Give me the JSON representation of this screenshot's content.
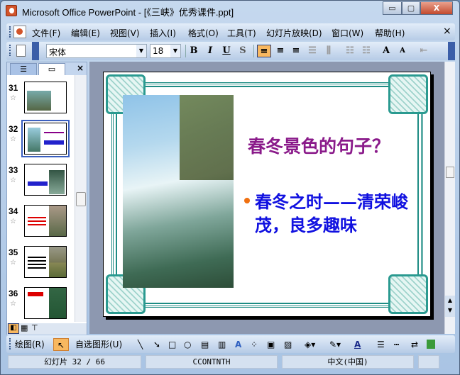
{
  "window": {
    "title": "Microsoft Office PowerPoint - [《三峡》优秀课件.ppt]",
    "minimize": "▭",
    "maximize": "▢",
    "close": "X"
  },
  "menu": {
    "items": [
      "文件(F)",
      "编辑(E)",
      "视图(V)",
      "插入(I)",
      "格式(O)",
      "工具(T)",
      "幻灯片放映(D)",
      "窗口(W)",
      "帮助(H)"
    ],
    "close": "×"
  },
  "format_toolbar": {
    "font": "宋体",
    "size": "18",
    "bold": "B",
    "italic": "I",
    "underline": "U",
    "shadow": "S",
    "increase_font": "A",
    "decrease_font": "A"
  },
  "left_pane": {
    "close": "×",
    "slides": [
      {
        "num": "31"
      },
      {
        "num": "32"
      },
      {
        "num": "33"
      },
      {
        "num": "34"
      },
      {
        "num": "35"
      },
      {
        "num": "36"
      }
    ],
    "selected": "32"
  },
  "slide": {
    "title": "春冬景色的句子？",
    "bullet": "春冬之时——清荣峻茂，良多趣味",
    "colors": {
      "title": "#8a1a8a",
      "bullet_text": "#1010e0",
      "bullet_dot": "#f07010",
      "border": "#1e8c84"
    }
  },
  "draw_toolbar": {
    "draw": "绘图(R)",
    "autoshapes": "自选图形(U)",
    "font_color": "A"
  },
  "status": {
    "slide": "幻灯片 32 / 66",
    "template": "CCONTNTH",
    "language": "中文(中国)"
  }
}
